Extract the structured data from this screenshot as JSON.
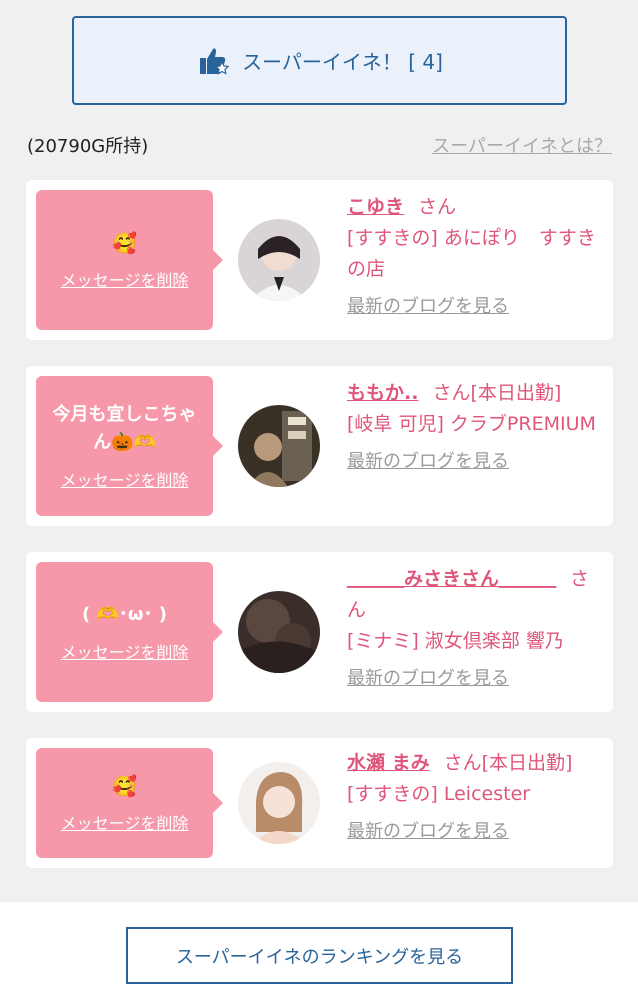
{
  "super_like": {
    "label": "スーパーイイネ！ [ 4]",
    "icon": "thumbs-up-star-icon"
  },
  "points_text": "(20790G所持)",
  "about_link": "スーパーイイネとは？",
  "cards": [
    {
      "message": "",
      "emoji": "🥰",
      "delete_label": "メッセージを削除",
      "name": "こゆき",
      "san": "さん",
      "shop": "[すすきの] あにぽり　すすきの店",
      "blog_label": "最新のブログを見る"
    },
    {
      "message": "今月も宜しこちゃん🎃🫶",
      "emoji": "",
      "delete_label": "メッセージを削除",
      "name": "ももか..",
      "san": "さん[本日出勤]",
      "shop": "[岐阜 可児] クラブPREMIUM",
      "blog_label": "最新のブログを見る"
    },
    {
      "message": "( 🫶･ω･ )",
      "emoji": "",
      "delete_label": "メッセージを削除",
      "name": "＿＿＿みさきさん＿＿＿",
      "san": "さん",
      "shop": "[ミナミ] 淑女倶楽部 響乃",
      "blog_label": "最新のブログを見る"
    },
    {
      "message": "",
      "emoji": "🥰",
      "delete_label": "メッセージを削除",
      "name": "水瀬 まみ",
      "san": "さん[本日出勤]",
      "shop": "[すすきの] Leicester",
      "blog_label": "最新のブログを見る"
    }
  ],
  "ranking_button": "スーパーイイネのランキングを見る",
  "colors": {
    "accent_blue": "#2a6399",
    "pink": "#f698a9",
    "name_pink": "#e0567a"
  }
}
